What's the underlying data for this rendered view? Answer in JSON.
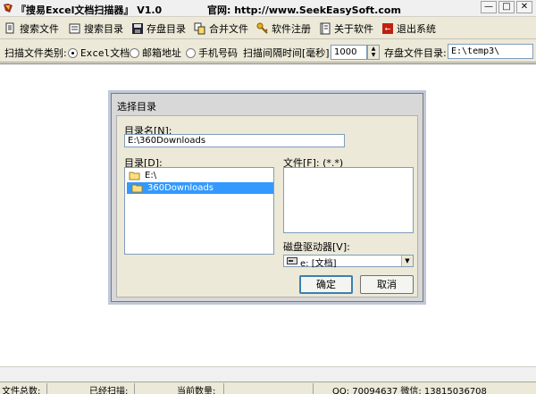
{
  "window": {
    "title": "『搜易Excel文档扫描器』 V1.0",
    "website": "官网: http://www.SeekEasySoft.com"
  },
  "toolbar": {
    "items": [
      {
        "label": "搜索文件",
        "icon": "search-file-icon"
      },
      {
        "label": "搜索目录",
        "icon": "search-directory-icon"
      },
      {
        "label": "存盘目录",
        "icon": "save-disk-icon"
      },
      {
        "label": "合并文件",
        "icon": "merge-files-icon"
      },
      {
        "label": "软件注册",
        "icon": "register-key-icon"
      },
      {
        "label": "关于软件",
        "icon": "about-book-icon"
      },
      {
        "label": "退出系统",
        "icon": "exit-icon"
      }
    ]
  },
  "options": {
    "category_label": "扫描文件类别:",
    "radios": [
      {
        "label": "Excel文档",
        "checked": true
      },
      {
        "label": "邮箱地址",
        "checked": false
      },
      {
        "label": "手机号码",
        "checked": false
      }
    ],
    "interval_label": "扫描间隔时间[毫秒]:",
    "interval_value": "1000",
    "save_dir_label": "存盘文件目录:",
    "save_dir_value": "E:\\temp3\\"
  },
  "dialog": {
    "title": "选择目录",
    "dir_name_label": "目录名[N]:",
    "dir_name_value": "E:\\360Downloads",
    "dirs_label": "目录[D]:",
    "tree": [
      {
        "label": "E:\\",
        "selected": false
      },
      {
        "label": "360Downloads",
        "selected": true
      }
    ],
    "files_label": "文件[F]: (*.*)",
    "drive_label": "磁盘驱动器[V]:",
    "drive_value": "e: [文档]",
    "ok_label": "确定",
    "cancel_label": "取消"
  },
  "status": {
    "total_label": "文件总数:",
    "scanned_label": "已经扫描:",
    "current_label": "当前数量:",
    "contact": "QQ: 70094637 微信: 13815036708"
  }
}
